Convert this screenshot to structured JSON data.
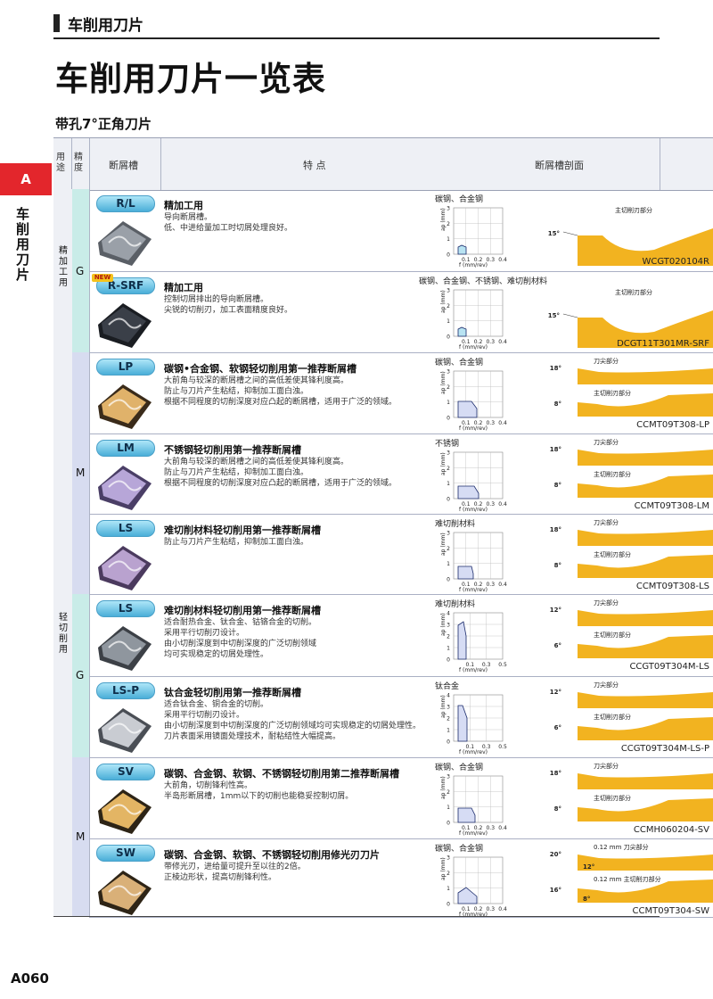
{
  "header": {
    "section": "车削用刀片",
    "title": "车削用刀片一览表",
    "subtitle": "带孔7°正角刀片"
  },
  "side": {
    "tab": "A",
    "label": "车削用刀片"
  },
  "table_headers": {
    "use": "用途",
    "precision": "精度",
    "groove": "断屑槽",
    "feature": "特 点",
    "section": "断屑槽剖面"
  },
  "groups": {
    "use_finish": "精加工用",
    "use_light": "轻切削用",
    "prec_g1": "G",
    "prec_m1": "M",
    "prec_g2": "G",
    "prec_m2": "M"
  },
  "labels": {
    "ap": "ap (mm)",
    "f": "f (mm/rev)",
    "new": "NEW"
  },
  "rows": [
    {
      "badge": "R/L",
      "title": "精加工用",
      "desc": "导向断屑槽。\n低、中进给量加工时切屑处理良好。",
      "material": "碳钢、合金钢",
      "code": "WCGT020104R",
      "ann1": "主切削刃部分",
      "ann2": "",
      "angle1": "15°",
      "angle2": "",
      "yticks": [
        "3",
        "2",
        "1",
        "0"
      ],
      "xticks": [
        "0.1",
        "0.2",
        "0.3",
        "0.4"
      ]
    },
    {
      "badge": "R-SRF",
      "title": "精加工用",
      "desc": "控制切屑排出的导向断屑槽。\n尖锐的切削刃，加工表面精度良好。",
      "material": "碳钢、合金钢、不锈钢、难切削材料",
      "code": "DCGT11T301MR-SRF",
      "ann1": "主切削刃部分",
      "ann2": "",
      "angle1": "15°",
      "angle2": "",
      "yticks": [
        "3",
        "2",
        "1",
        "0"
      ],
      "xticks": [
        "0.1",
        "0.2",
        "0.3",
        "0.4"
      ]
    },
    {
      "badge": "LP",
      "title": "碳钢•合金钢、软钢轻切削用第一推荐断屑槽",
      "desc": "大前角与较深的断屑槽之间的高低差使其锋利度高。\n防止与刀片产生粘结，抑制加工面白浊。\n根据不同程度的切削深度对应凸起的断屑槽，适用于广泛的领域。",
      "material": "碳钢、合金钢",
      "code": "CCMT09T308-LP",
      "ann1": "刀尖部分",
      "ann2": "主切削刃部分",
      "angle1": "18°",
      "angle2": "8°",
      "yticks": [
        "3",
        "2",
        "1",
        "0"
      ],
      "xticks": [
        "0.1",
        "0.2",
        "0.3",
        "0.4"
      ]
    },
    {
      "badge": "LM",
      "title": "不锈钢轻切削用第一推荐断屑槽",
      "desc": "大前角与较深的断屑槽之间的高低差使其锋利度高。\n防止与刀片产生粘结，抑制加工面白浊。\n根据不同程度的切削深度对应凸起的断屑槽，适用于广泛的领域。",
      "material": "不锈钢",
      "code": "CCMT09T308-LM",
      "ann1": "刀尖部分",
      "ann2": "主切削刃部分",
      "angle1": "18°",
      "angle2": "8°",
      "yticks": [
        "3",
        "2",
        "1",
        "0"
      ],
      "xticks": [
        "0.1",
        "0.2",
        "0.3",
        "0.4"
      ]
    },
    {
      "badge": "LS",
      "title": "难切削材料轻切削用第一推荐断屑槽",
      "desc": "防止与刀片产生粘结，抑制加工面白浊。",
      "material": "难切削材料",
      "code": "CCMT09T308-LS",
      "ann1": "刀尖部分",
      "ann2": "主切削刃部分",
      "angle1": "18°",
      "angle2": "8°",
      "yticks": [
        "3",
        "2",
        "1",
        "0"
      ],
      "xticks": [
        "0.1",
        "0.2",
        "0.3",
        "0.4"
      ]
    },
    {
      "badge": "LS",
      "title": "难切削材料轻切削用第一推荐断屑槽",
      "desc": "适合耐热合金、钛合金、钴铬合金的切削。\n采用平行切削刃设计。\n由小切削深度到中切削深度的广泛切削领域\n均可实现稳定的切屑处理性。",
      "material": "难切削材料",
      "code": "CCGT09T304M-LS",
      "ann1": "刀尖部分",
      "ann2": "主切削刃部分",
      "angle1": "12°",
      "angle2": "6°",
      "yticks": [
        "4",
        "3",
        "2",
        "1",
        "0"
      ],
      "xticks": [
        "0.1",
        "0.3",
        "0.5"
      ]
    },
    {
      "badge": "LS-P",
      "title": "钛合金轻切削用第一推荐断屑槽",
      "desc": "适合钛合金、铜合金的切削。\n采用平行切削刃设计。\n由小切削深度到中切削深度的广泛切削领域均可实现稳定的切屑处理性。\n刀片表面采用镜面处理技术，耐粘结性大幅提高。",
      "material": "钛合金",
      "code": "CCGT09T304M-LS-P",
      "ann1": "刀尖部分",
      "ann2": "主切削刃部分",
      "angle1": "12°",
      "angle2": "6°",
      "yticks": [
        "4",
        "3",
        "2",
        "1",
        "0"
      ],
      "xticks": [
        "0.1",
        "0.3",
        "0.5"
      ]
    },
    {
      "badge": "SV",
      "title": "碳钢、合金钢、软钢、不锈钢轻切削用第二推荐断屑槽",
      "desc": "大前角，切削锋利性高。\n半岛形断屑槽，1mm以下的切削也能稳妥控制切屑。",
      "material": "碳钢、合金钢",
      "code": "CCMH060204-SV",
      "ann1": "刀尖部分",
      "ann2": "主切削刃部分",
      "angle1": "18°",
      "angle2": "8°",
      "yticks": [
        "3",
        "2",
        "1",
        "0"
      ],
      "xticks": [
        "0.1",
        "0.2",
        "0.3",
        "0.4"
      ]
    },
    {
      "badge": "SW",
      "title": "碳钢、合金钢、软钢、不锈钢轻切削用修光刃刀片",
      "desc": "带修光刃，进给量可提升至以往的2倍。\n正棱边形状，提高切削锋利性。",
      "material": "碳钢、合金钢",
      "code": "CCMT09T304-SW",
      "ann1": "0.12 mm 刀尖部分",
      "ann2": "0.12 mm 主切削刃部分",
      "angle1": "20°",
      "angle2": "16°",
      "angle3": "12°",
      "angle4": "8°",
      "yticks": [
        "3",
        "2",
        "1",
        "0"
      ],
      "xticks": [
        "0.1",
        "0.2",
        "0.3",
        "0.4"
      ]
    }
  ],
  "page": {
    "number": "A060"
  }
}
